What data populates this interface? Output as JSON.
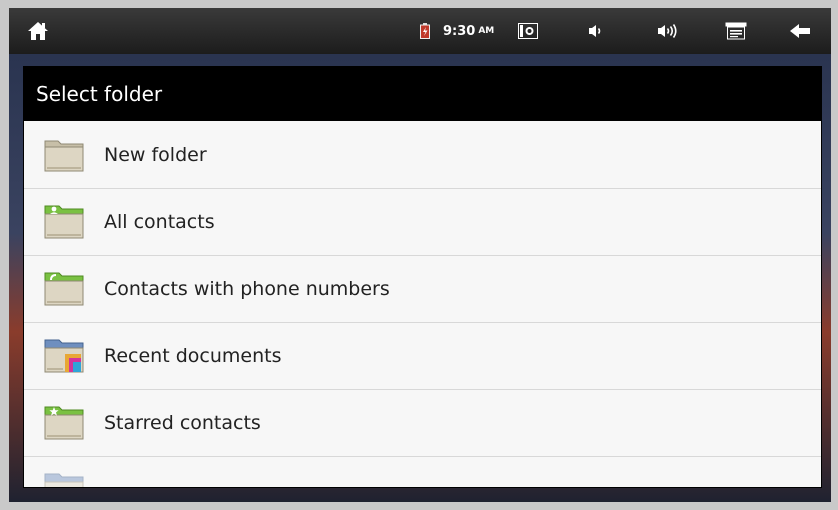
{
  "status_bar": {
    "time": "9:30",
    "ampm": "AM",
    "icons": [
      "home-icon",
      "battery-icon",
      "screenshot-icon",
      "volume-down-icon",
      "volume-up-icon",
      "menu-icon",
      "back-arrow-icon"
    ]
  },
  "dialog": {
    "title": "Select folder",
    "items": [
      {
        "label": "New folder",
        "icon": "plain-folder-icon"
      },
      {
        "label": "All contacts",
        "icon": "contacts-folder-icon"
      },
      {
        "label": "Contacts with phone numbers",
        "icon": "phone-folder-icon"
      },
      {
        "label": "Recent documents",
        "icon": "documents-folder-icon"
      },
      {
        "label": "Starred contacts",
        "icon": "starred-folder-icon"
      },
      {
        "label": "",
        "icon": "partially-visible-folder-icon"
      }
    ]
  },
  "colors": {
    "dialog_background": "#f7f7f7",
    "title_bar": "#000000",
    "folder_accent": "#7ac142"
  }
}
